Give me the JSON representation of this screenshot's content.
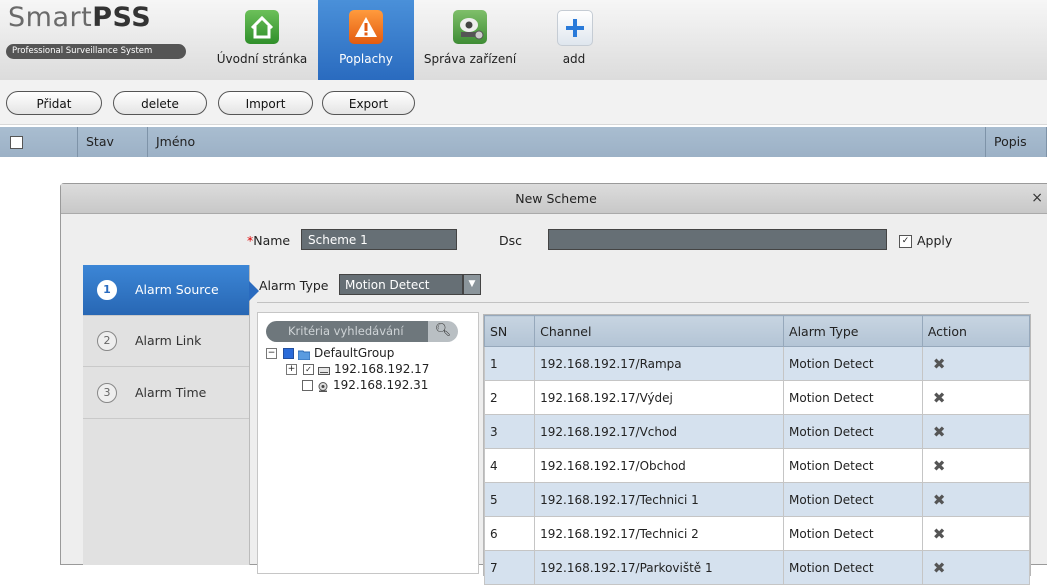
{
  "app": {
    "logo_main": "Smart",
    "logo_bold": "PSS",
    "logo_sub": "Professional Surveillance System"
  },
  "nav": [
    {
      "label": "Úvodní stránka",
      "icon": "home-icon"
    },
    {
      "label": "Poplachy",
      "icon": "alarm-icon"
    },
    {
      "label": "Správa zařízení",
      "icon": "camera-settings-icon"
    },
    {
      "label": "add",
      "icon": "plus-icon"
    }
  ],
  "toolbar": {
    "add_label": "Přidat",
    "delete_label": "delete",
    "import_label": "Import",
    "export_label": "Export"
  },
  "list_header": {
    "status": "Stav",
    "name": "Jméno",
    "description": "Popis"
  },
  "dialog": {
    "title": "New Scheme",
    "close": "×",
    "name_label": "Name",
    "name_required_mark": "*",
    "name_value": "Scheme 1",
    "dsc_label": "Dsc",
    "dsc_value": "",
    "apply_label": "Apply",
    "apply_checked": true,
    "steps": [
      {
        "num": "1",
        "label": "Alarm Source"
      },
      {
        "num": "2",
        "label": "Alarm Link"
      },
      {
        "num": "3",
        "label": "Alarm Time"
      }
    ],
    "alarm_type_label": "Alarm Type",
    "alarm_type_value": "Motion Detect",
    "search_placeholder": "Kritéria vyhledávání",
    "tree": {
      "group": "DefaultGroup",
      "device1": "192.168.192.17",
      "device2": "192.168.192.31"
    },
    "table": {
      "headers": [
        "SN",
        "Channel",
        "Alarm Type",
        "Action"
      ],
      "rows": [
        {
          "sn": "1",
          "channel": "192.168.192.17/Rampa",
          "type": "Motion Detect"
        },
        {
          "sn": "2",
          "channel": "192.168.192.17/Výdej",
          "type": "Motion Detect"
        },
        {
          "sn": "3",
          "channel": "192.168.192.17/Vchod",
          "type": "Motion Detect"
        },
        {
          "sn": "4",
          "channel": "192.168.192.17/Obchod",
          "type": "Motion Detect"
        },
        {
          "sn": "5",
          "channel": "192.168.192.17/Technici 1",
          "type": "Motion Detect"
        },
        {
          "sn": "6",
          "channel": "192.168.192.17/Technici 2",
          "type": "Motion Detect"
        },
        {
          "sn": "7",
          "channel": "192.168.192.17/Parkoviště 1",
          "type": "Motion Detect"
        }
      ],
      "action_icon": "delete-x-icon",
      "action_glyph": "✖"
    }
  },
  "colors": {
    "accent": "#2a6bbf",
    "header_blue": "#a9bdd0",
    "row_alt": "#d5e1ee",
    "input_bg": "#666f75"
  }
}
